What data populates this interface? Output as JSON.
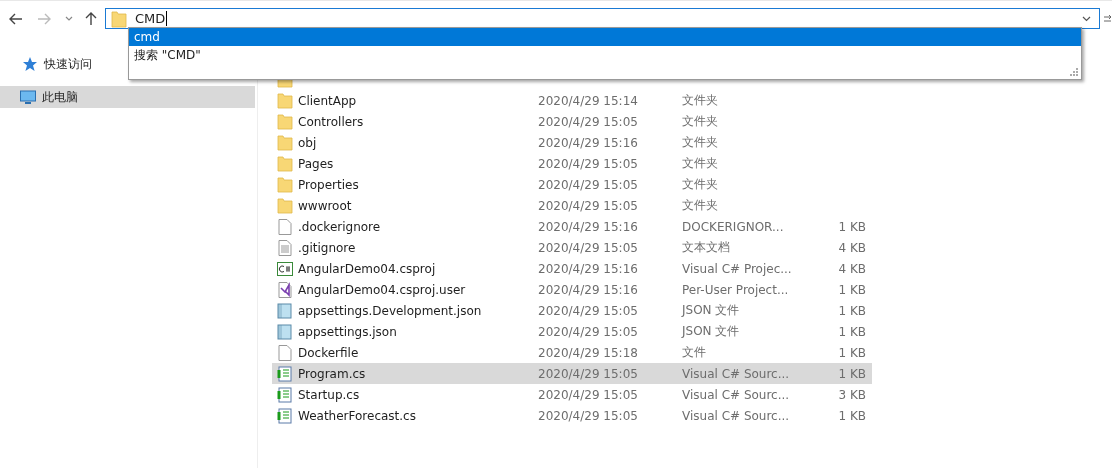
{
  "address_bar": {
    "value": "CMD"
  },
  "suggestions": [
    {
      "label": "cmd",
      "selected": true
    },
    {
      "label": "搜索 \"CMD\"",
      "selected": false
    }
  ],
  "sidebar": {
    "items": [
      {
        "label": "快速访问",
        "kind": "star",
        "selected": false
      },
      {
        "label": "此电脑",
        "kind": "pc",
        "selected": true
      }
    ]
  },
  "files": [
    {
      "kind": "folder",
      "selected": false
    },
    {
      "kind": "folder",
      "name": "ClientApp",
      "date": "2020/4/29 15:14",
      "type": "文件夹",
      "selected": false
    },
    {
      "kind": "folder",
      "name": "Controllers",
      "date": "2020/4/29 15:05",
      "type": "文件夹",
      "selected": false
    },
    {
      "kind": "folder",
      "name": "obj",
      "date": "2020/4/29 15:16",
      "type": "文件夹",
      "selected": false
    },
    {
      "kind": "folder",
      "name": "Pages",
      "date": "2020/4/29 15:05",
      "type": "文件夹",
      "selected": false
    },
    {
      "kind": "folder",
      "name": "Properties",
      "date": "2020/4/29 15:05",
      "type": "文件夹",
      "selected": false
    },
    {
      "kind": "folder",
      "name": "wwwroot",
      "date": "2020/4/29 15:05",
      "type": "文件夹",
      "selected": false
    },
    {
      "kind": "blank",
      "name": ".dockerignore",
      "date": "2020/4/29 15:16",
      "type": "DOCKERIGNOR...",
      "size": "1 KB",
      "selected": false
    },
    {
      "kind": "text",
      "name": ".gitignore",
      "date": "2020/4/29 15:05",
      "type": "文本文档",
      "size": "4 KB",
      "selected": false
    },
    {
      "kind": "csproj",
      "name": "AngularDemo04.csproj",
      "date": "2020/4/29 15:16",
      "type": "Visual C# Projec...",
      "size": "4 KB",
      "selected": false
    },
    {
      "kind": "vsuser",
      "name": "AngularDemo04.csproj.user",
      "date": "2020/4/29 15:16",
      "type": "Per-User Project...",
      "size": "1 KB",
      "selected": false
    },
    {
      "kind": "json",
      "name": "appsettings.Development.json",
      "date": "2020/4/29 15:05",
      "type": "JSON 文件",
      "size": "1 KB",
      "selected": false
    },
    {
      "kind": "json",
      "name": "appsettings.json",
      "date": "2020/4/29 15:05",
      "type": "JSON 文件",
      "size": "1 KB",
      "selected": false
    },
    {
      "kind": "blank",
      "name": "Dockerfile",
      "date": "2020/4/29 15:18",
      "type": "文件",
      "size": "1 KB",
      "selected": false
    },
    {
      "kind": "cs",
      "name": "Program.cs",
      "date": "2020/4/29 15:05",
      "type": "Visual C# Sourc...",
      "size": "1 KB",
      "selected": true
    },
    {
      "kind": "cs",
      "name": "Startup.cs",
      "date": "2020/4/29 15:05",
      "type": "Visual C# Sourc...",
      "size": "3 KB",
      "selected": false
    },
    {
      "kind": "cs",
      "name": "WeatherForecast.cs",
      "date": "2020/4/29 15:05",
      "type": "Visual C# Sourc...",
      "size": "1 KB",
      "selected": false
    }
  ]
}
